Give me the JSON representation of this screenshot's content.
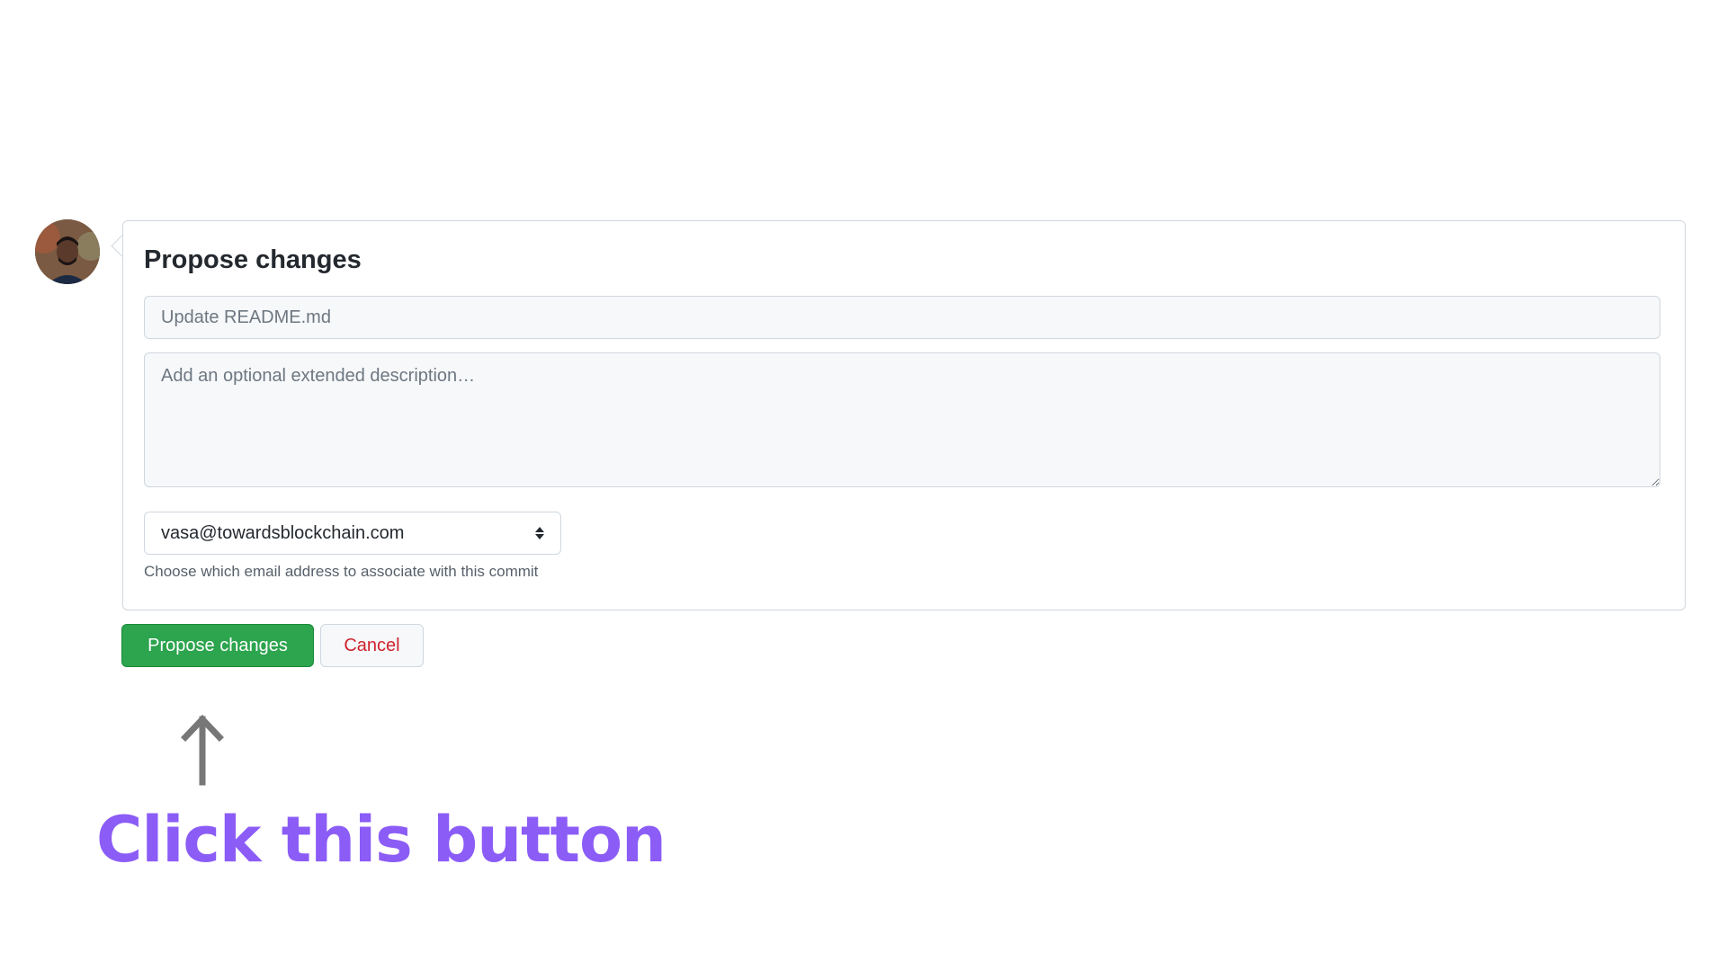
{
  "form": {
    "heading": "Propose changes",
    "summary_placeholder": "Update README.md",
    "description_placeholder": "Add an optional extended description…",
    "email_selected": "vasa@towardsblockchain.com",
    "email_hint": "Choose which email address to associate with this commit"
  },
  "actions": {
    "propose_label": "Propose changes",
    "cancel_label": "Cancel"
  },
  "annotation": {
    "callout_text": "Click this button",
    "callout_color": "#8b5cf6",
    "arrow_icon": "arrow-up-icon"
  },
  "colors": {
    "primary_button": "#2da44e",
    "cancel_text": "#cf222e"
  }
}
